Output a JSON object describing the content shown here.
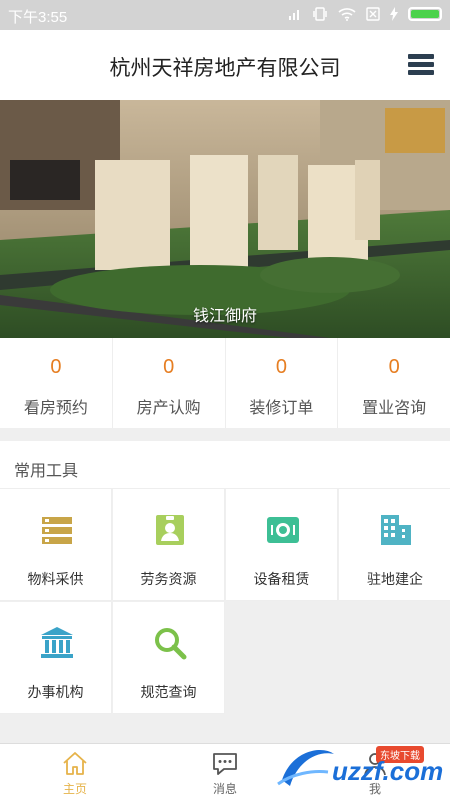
{
  "status_bar": {
    "time": "下午3:55",
    "battery_level": 1.0
  },
  "header": {
    "title": "杭州天祥房地产有限公司",
    "menu_icon": "menu-icon"
  },
  "banner": {
    "caption": "钱江御府"
  },
  "stats": [
    {
      "value": "0",
      "label": "看房预约"
    },
    {
      "value": "0",
      "label": "房产认购"
    },
    {
      "value": "0",
      "label": "装修订单"
    },
    {
      "value": "0",
      "label": "置业咨询"
    }
  ],
  "tools": {
    "title": "常用工具",
    "items": [
      {
        "label": "物料采供",
        "icon": "list-icon",
        "color": "#c8a548"
      },
      {
        "label": "劳务资源",
        "icon": "id-badge-icon",
        "color": "#a8cf5d"
      },
      {
        "label": "设备租赁",
        "icon": "device-icon",
        "color": "#3dbf95"
      },
      {
        "label": "驻地建企",
        "icon": "building-icon",
        "color": "#4fb3c4"
      },
      {
        "label": "办事机构",
        "icon": "institution-icon",
        "color": "#3aa3c8"
      },
      {
        "label": "规范查询",
        "icon": "search-icon",
        "color": "#7cc14a"
      }
    ]
  },
  "tabbar": {
    "tabs": [
      {
        "label": "主页",
        "icon": "home-icon",
        "active": true
      },
      {
        "label": "消息",
        "icon": "message-icon",
        "active": false
      },
      {
        "label": "我",
        "icon": "user-icon",
        "active": false
      }
    ]
  },
  "watermark": {
    "text": "uzzf.com",
    "badge": "东坡下载"
  }
}
